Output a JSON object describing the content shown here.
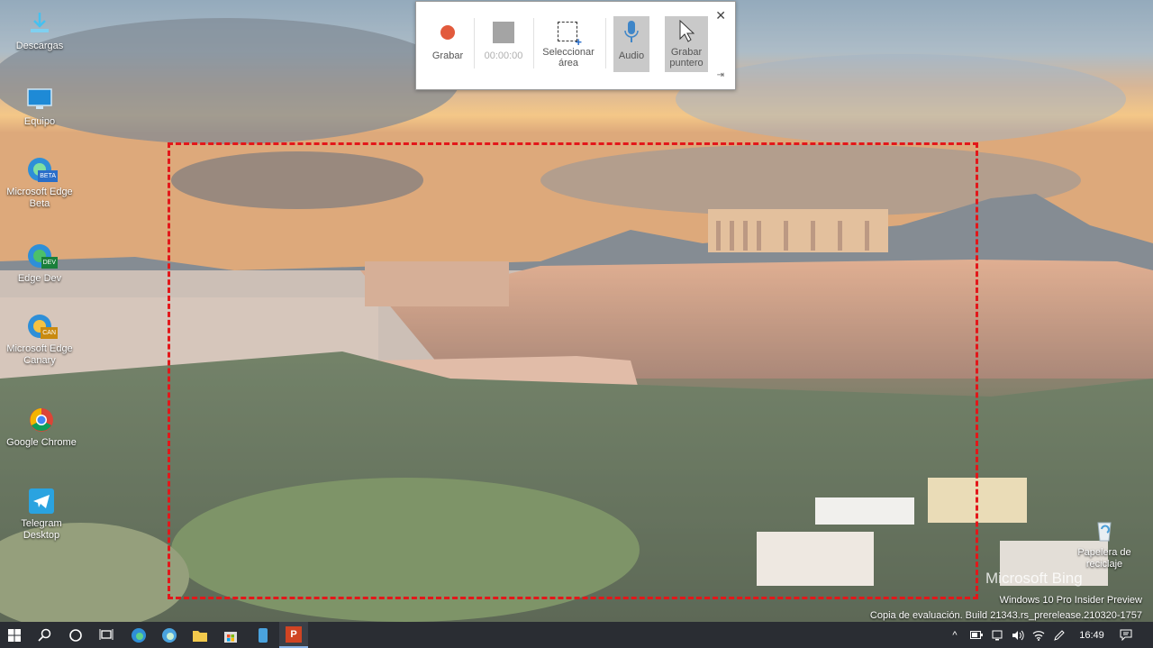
{
  "recorder": {
    "record_label": "Grabar",
    "timer": "00:00:00",
    "select_area_label": "Seleccionar área",
    "audio_label": "Audio",
    "pointer_label": "Grabar puntero",
    "close_glyph": "✕",
    "pin_glyph": "⇥",
    "record_color": "#e25a3c"
  },
  "desktop": {
    "icons": [
      {
        "label": "Descargas",
        "icon": "downloads-icon"
      },
      {
        "label": "Equipo",
        "icon": "computer-icon"
      },
      {
        "label": "Microsoft Edge Beta",
        "icon": "edge-beta-icon"
      },
      {
        "label": "Edge Dev",
        "icon": "edge-dev-icon"
      },
      {
        "label": "Microsoft Edge Canary",
        "icon": "edge-canary-icon"
      },
      {
        "label": "Google Chrome",
        "icon": "chrome-icon"
      },
      {
        "label": "Telegram Desktop",
        "icon": "telegram-icon"
      },
      {
        "label": "Papelera de reciclaje",
        "icon": "recycle-bin-icon"
      }
    ],
    "badges": {
      "beta": "BETA",
      "dev": "DEV",
      "canary": "CAN"
    },
    "bing_label": "Microsoft Bing",
    "watermark_line1": "Windows 10 Pro Insider Preview",
    "watermark_line2": "Copia de evaluación. Build 21343.rs_prerelease.210320-1757"
  },
  "selection": {
    "border_color": "#e3171a"
  },
  "taskbar": {
    "time": "16:49",
    "up_arrow": "^",
    "app_letters": {
      "powerpoint": "P"
    }
  }
}
